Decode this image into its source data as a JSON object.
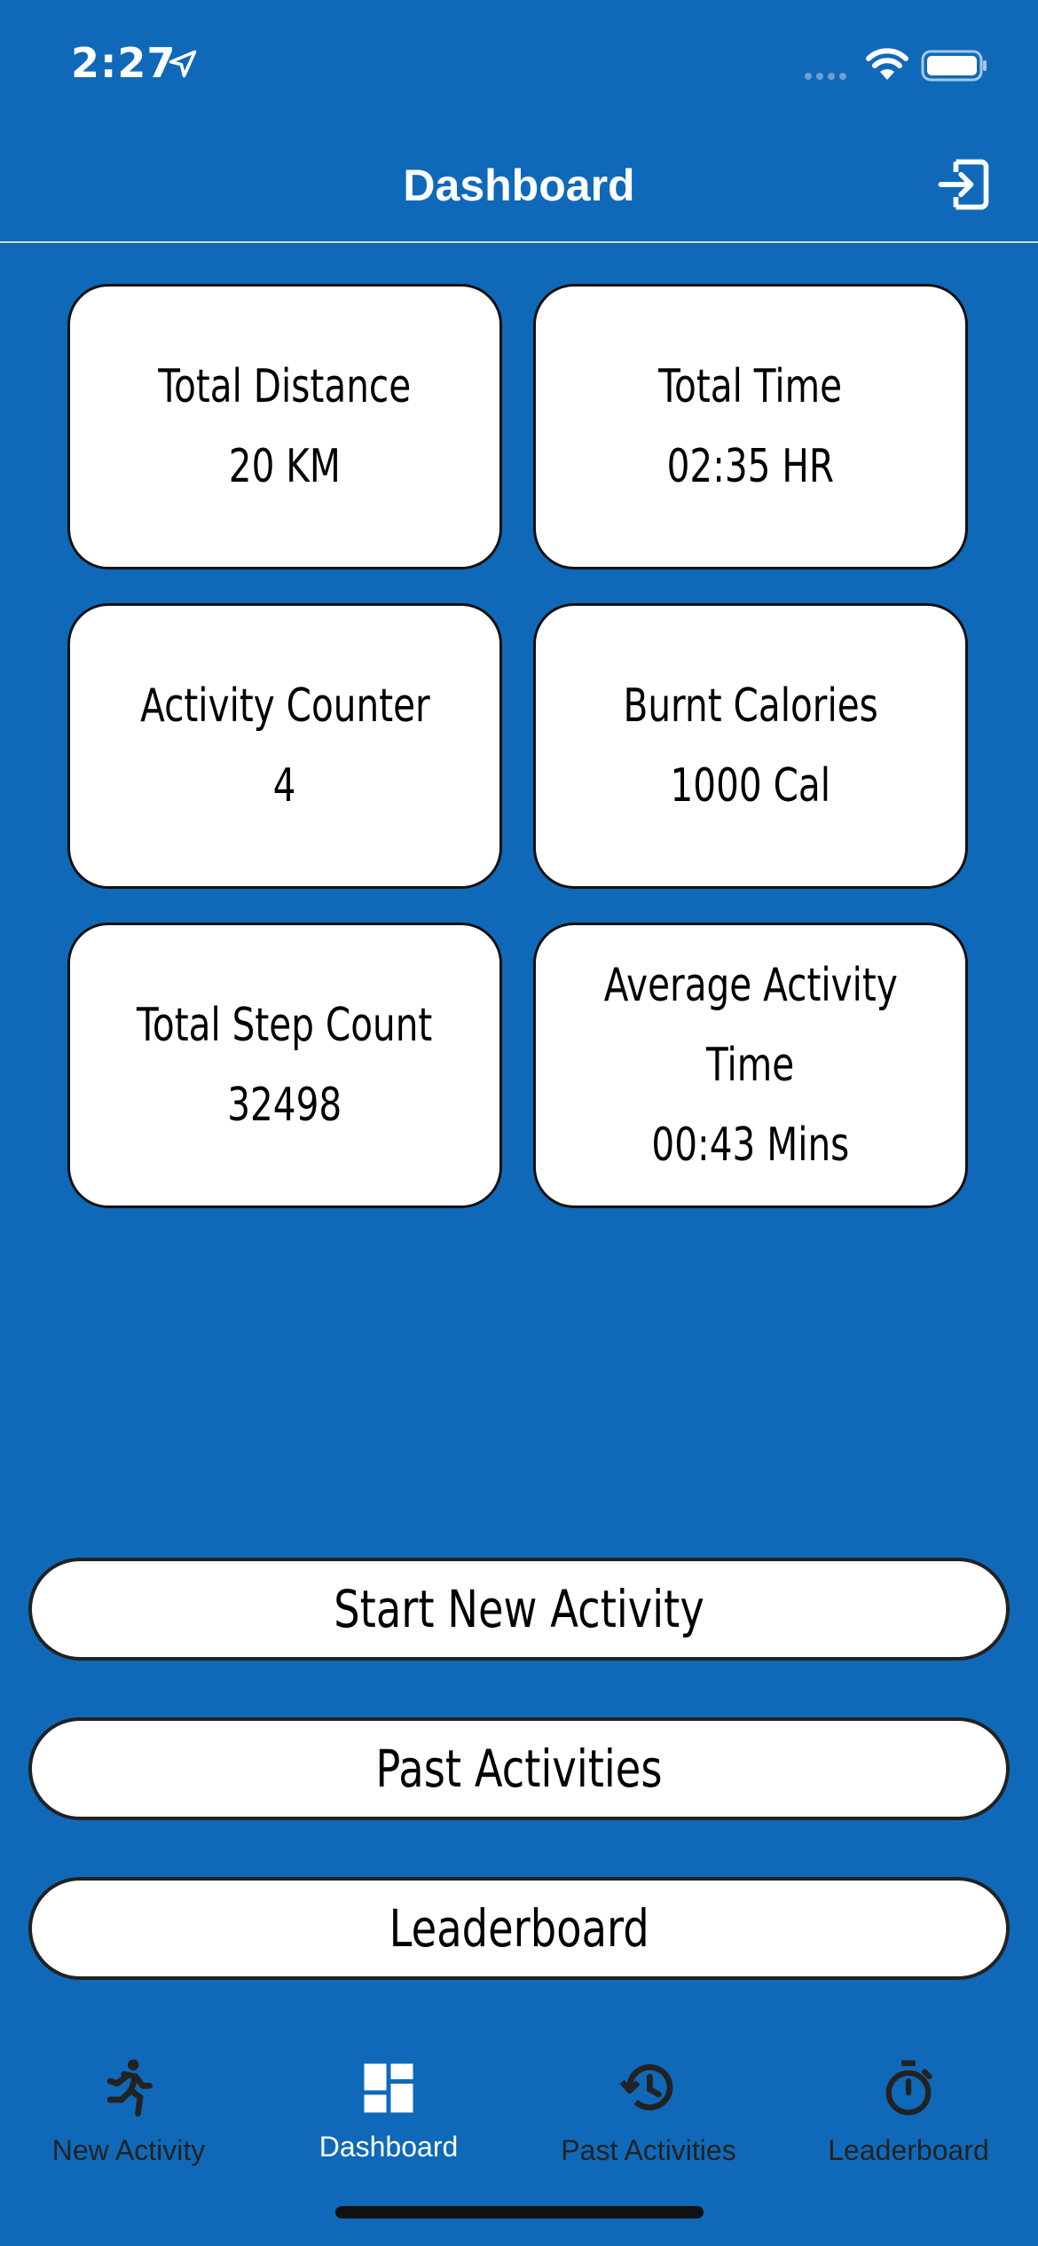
{
  "status_bar": {
    "time": "2:27"
  },
  "header": {
    "title": "Dashboard",
    "logout_icon": "logout-icon"
  },
  "stats": [
    {
      "label": "Total Distance",
      "value": "20 KM"
    },
    {
      "label": "Total Time",
      "value": "02:35 HR"
    },
    {
      "label": "Activity Counter",
      "value": "4"
    },
    {
      "label": "Burnt Calories",
      "value": "1000 Cal"
    },
    {
      "label": "Total Step Count",
      "value": "32498"
    },
    {
      "label_line1": "Average Activity",
      "label_line2": "Time",
      "value": "00:43 Mins"
    }
  ],
  "actions": {
    "start_new_activity": "Start New Activity",
    "past_activities": "Past Activities",
    "leaderboard": "Leaderboard"
  },
  "tabs": [
    {
      "label": "New Activity",
      "icon": "running-icon"
    },
    {
      "label": "Dashboard",
      "icon": "dashboard-icon",
      "active": true
    },
    {
      "label": "Past Activities",
      "icon": "history-icon"
    },
    {
      "label": "Leaderboard",
      "icon": "stopwatch-icon"
    }
  ],
  "colors": {
    "background": "#0f69b8",
    "card": "#ffffff",
    "active_tab": "#ffffff",
    "inactive_tab": "#222222"
  }
}
